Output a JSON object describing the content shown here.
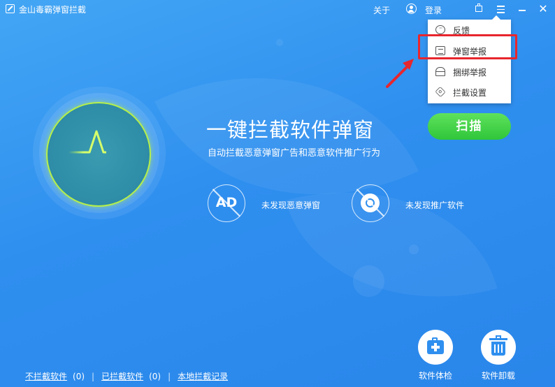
{
  "app": {
    "title": "金山毒霸弹窗拦截"
  },
  "titlebar": {
    "about": "关于",
    "login": "登录"
  },
  "dropdown": {
    "items": [
      {
        "label": "反馈",
        "icon": "feedback-icon"
      },
      {
        "label": "弹窗举报",
        "icon": "popup-report-icon"
      },
      {
        "label": "捆绑举报",
        "icon": "bundle-report-icon"
      },
      {
        "label": "拦截设置",
        "icon": "settings-icon"
      }
    ]
  },
  "main": {
    "headline": "一键拦截软件弹窗",
    "subline": "自动拦截恶意弹窗广告和恶意软件推广行为",
    "scan_button": "扫描"
  },
  "status": {
    "ad_icon_text": "AD",
    "ad_label": "未发现恶意弹窗",
    "promo_label": "未发现推广软件"
  },
  "tools": [
    {
      "label": "软件体检",
      "icon": "medkit-icon"
    },
    {
      "label": "软件卸载",
      "icon": "trash-icon"
    }
  ],
  "footer": {
    "not_blocked": "不拦截软件",
    "not_blocked_count": "(0)",
    "blocked": "已拦截软件",
    "blocked_count": "(0)",
    "records": "本地拦截记录",
    "sep": "|"
  },
  "colors": {
    "background": "#2f8fef",
    "scan_button": "#2fc63a",
    "highlight": "#e8262d",
    "gauge_ring": "#b6f04a"
  }
}
